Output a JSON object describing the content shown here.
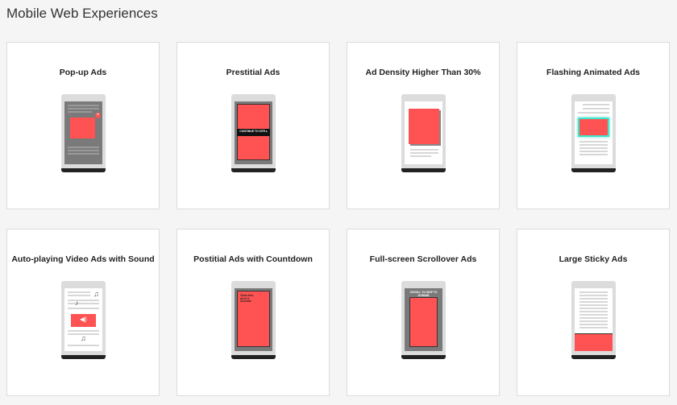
{
  "page": {
    "title": "Mobile Web Experiences"
  },
  "cards": [
    {
      "title": "Pop-up Ads"
    },
    {
      "title": "Prestitial Ads",
      "overlay_text": "CONTINUE TO SITE ▸"
    },
    {
      "title": "Ad Density Higher Than 30%"
    },
    {
      "title": "Flashing Animated Ads"
    },
    {
      "title": "Auto-playing Video Ads with Sound"
    },
    {
      "title": "Postitial Ads with Countdown",
      "overlay_text": "Close this ad in 5 seconds"
    },
    {
      "title": "Full-screen Scrollover Ads",
      "overlay_text": "SCROLL TO SKIP TO DOMAIN"
    },
    {
      "title": "Large Sticky Ads"
    }
  ],
  "colors": {
    "ad": "#ff5252",
    "flash_glow": "#42e3c8",
    "dim": "#7a7a7a"
  },
  "icons": [
    "close-x-icon",
    "speaker-icon",
    "music-note-icon"
  ]
}
